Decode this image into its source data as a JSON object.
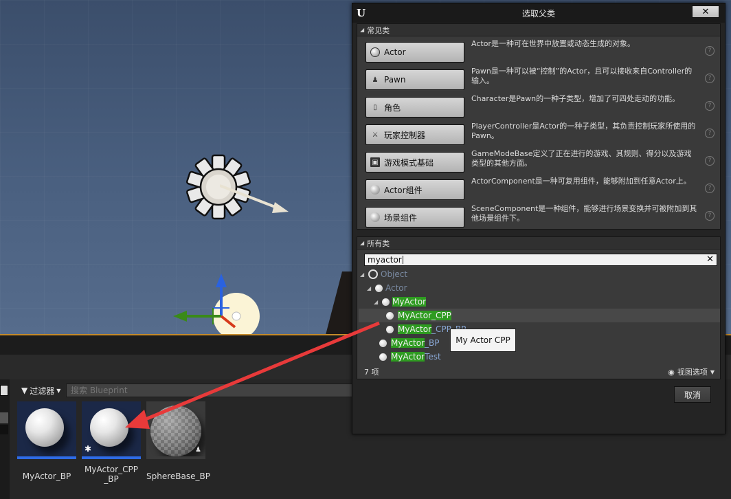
{
  "dialog": {
    "title": "选取父类",
    "close_label": "✕",
    "common_header": "常见类",
    "common_classes": [
      {
        "label": "Actor",
        "icon": "sphere-icon",
        "desc": "Actor是一种可在世界中放置或动态生成的对象。"
      },
      {
        "label": "Pawn",
        "icon": "pawn-icon",
        "desc": "Pawn是一种可以被“控制”的Actor，且可以接收来自Controller的输入。"
      },
      {
        "label": "角色",
        "icon": "character-icon",
        "desc": "Character是Pawn的一种子类型，增加了可四处走动的功能。"
      },
      {
        "label": "玩家控制器",
        "icon": "controller-icon",
        "desc": "PlayerController是Actor的一种子类型，其负责控制玩家所使用的Pawn。"
      },
      {
        "label": "游戏模式基础",
        "icon": "gamemode-icon",
        "desc": "GameModeBase定义了正在进行的游戏、其规则、得分以及游戏类型的其他方面。"
      },
      {
        "label": "Actor组件",
        "icon": "component-icon",
        "desc": "ActorComponent是一种可复用组件，能够附加到任意Actor上。"
      },
      {
        "label": "场景组件",
        "icon": "scene-component-icon",
        "desc": "SceneComponent是一种组件，能够进行场景变换并可被附加到其他场景组件下。"
      }
    ],
    "help_glyph": "?",
    "all_header": "所有类",
    "search_value": "myactor",
    "clear_glyph": "✕",
    "tree": {
      "object": "Object",
      "actor": "Actor",
      "myactor_hl": "MyActor",
      "cpp_hl": "MyActor",
      "cpp_rest": "_CPP",
      "cppbp_hl": "MyActor",
      "cppbp_rest": "_CPP_BP",
      "bp_hl": "MyActor",
      "bp_rest": "_BP",
      "test_hl": "MyActor",
      "test_rest": "Test"
    },
    "item_count": "7 项",
    "view_options": "视图选项",
    "cancel_label": "取消"
  },
  "tooltip": "My Actor CPP",
  "content_browser": {
    "filter_label": "过滤器",
    "search_placeholder": "搜索 Blueprint",
    "assets": [
      {
        "name": "MyActor_BP"
      },
      {
        "name": "MyActor_CPP_BP"
      },
      {
        "name": "SphereBase_BP"
      }
    ]
  },
  "colors": {
    "highlight": "#2e9b20",
    "annotation_arrow": "#e83a3a",
    "selection_bar": "#2e6be6"
  }
}
